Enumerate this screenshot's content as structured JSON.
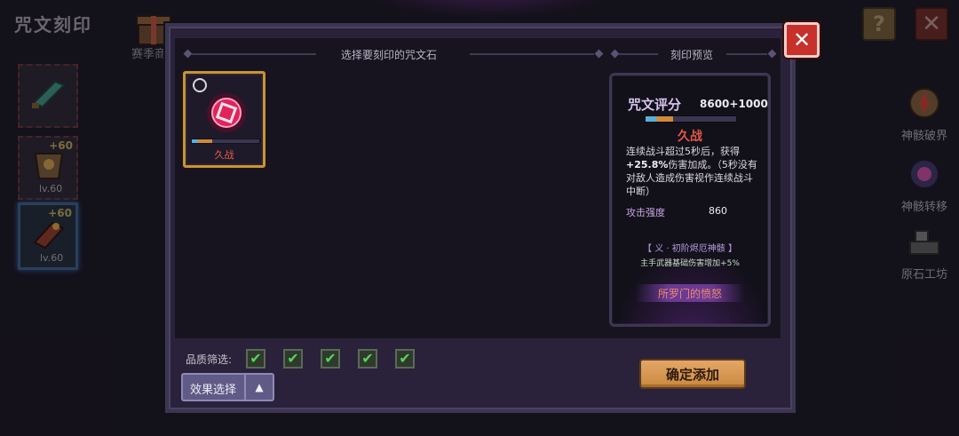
{
  "screen": {
    "title": "咒文刻印"
  },
  "top_bar": {
    "season_label": "赛季商",
    "help_label": "?",
    "close_label": "✕"
  },
  "left_slots": [
    {
      "level": "",
      "plus": ""
    },
    {
      "level": "lv.60",
      "plus": "+60"
    },
    {
      "level": "lv.60",
      "plus": "+60"
    }
  ],
  "right_nav": [
    {
      "label": "神骸破界",
      "icon": "relic-break-icon"
    },
    {
      "label": "神骸转移",
      "icon": "relic-transfer-icon"
    },
    {
      "label": "原石工坊",
      "icon": "workshop-icon"
    }
  ],
  "panel": {
    "left_header": "选择要刻印的咒文石",
    "right_header": "刻印预览",
    "close_label": "✕"
  },
  "runes": [
    {
      "name": "久战",
      "progress_percent": 30,
      "selected": true
    }
  ],
  "preview": {
    "score_label": "咒文评分",
    "score_value": "8600+1000",
    "score_progress_percent": 30,
    "rune_name": "久战",
    "desc_prefix": "连续战斗超过5秒后，获得",
    "desc_highlight": "+25.8%",
    "desc_suffix": "伤害加成。（5秒没有对敌人造成伤害视作连续战斗中断）",
    "stat_label": "攻击强度",
    "stat_value": "860",
    "set_name": "【 义 · 初阶烬厄神骸 】",
    "set_bonus": "主手武器基础伤害增加+5%",
    "relic_name": "所罗门的愤怒"
  },
  "filter": {
    "label": "品质筛选:",
    "checks": [
      {
        "checked": true,
        "color": "#5ad25a"
      },
      {
        "checked": true,
        "color": "#5ad25a"
      },
      {
        "checked": true,
        "color": "#5ad25a"
      },
      {
        "checked": true,
        "color": "#5ad25a"
      },
      {
        "checked": true,
        "color": "#5ad25a"
      }
    ],
    "check_glyph": "✔"
  },
  "effect_button": {
    "label": "效果选择",
    "arrow": "▲"
  },
  "confirm_button": {
    "label": "确定添加"
  },
  "colors": {
    "rune_name_red": "#e35645",
    "accent_gold": "#c8952f",
    "confirm_orange": "#d9994f",
    "close_red": "#c8302b"
  }
}
